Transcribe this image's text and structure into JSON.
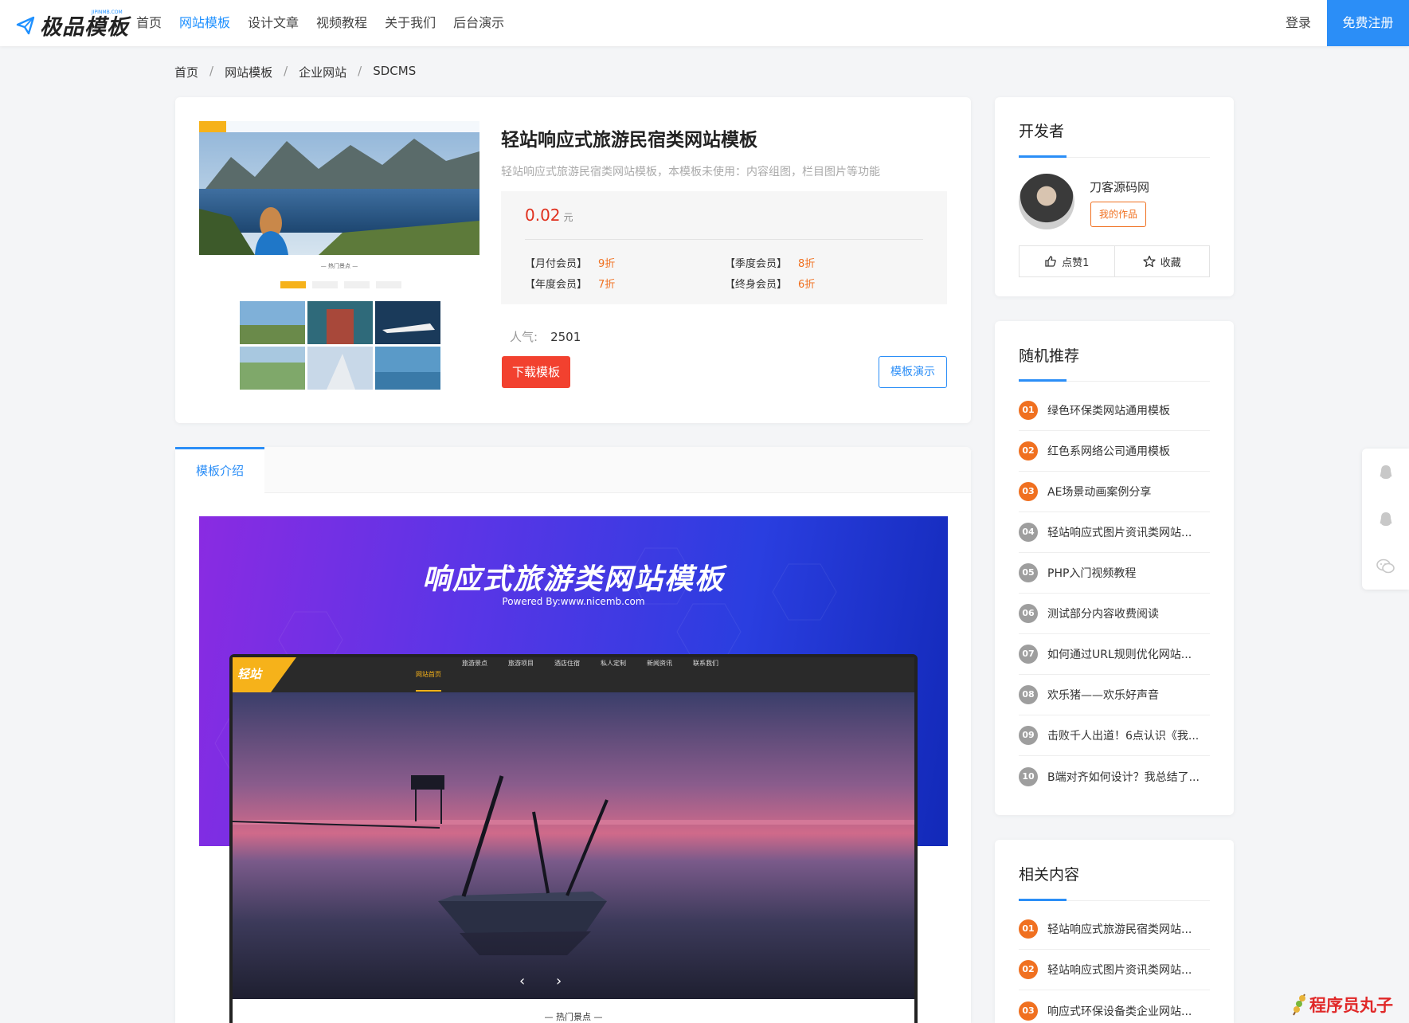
{
  "header": {
    "logo_text": "极品模板",
    "logo_sub": "JIPINMB.COM",
    "nav": [
      {
        "label": "首页",
        "active": false
      },
      {
        "label": "网站模板",
        "active": true
      },
      {
        "label": "设计文章",
        "active": false
      },
      {
        "label": "视频教程",
        "active": false
      },
      {
        "label": "关于我们",
        "active": false
      },
      {
        "label": "后台演示",
        "active": false
      }
    ],
    "login": "登录",
    "register": "免费注册"
  },
  "breadcrumb": [
    "首页",
    "网站模板",
    "企业网站",
    "SDCMS"
  ],
  "product": {
    "title": "轻站响应式旅游民宿类网站模板",
    "description": "轻站响应式旅游民宿类网站模板，本模板未使用：内容组图，栏目图片等功能",
    "price": "0.02",
    "price_unit": "元",
    "memberships": [
      {
        "label": "【月付会员】",
        "discount": "9折"
      },
      {
        "label": "【季度会员】",
        "discount": "8折"
      },
      {
        "label": "【年度会员】",
        "discount": "7折"
      },
      {
        "label": "【终身会员】",
        "discount": "6折"
      }
    ],
    "popularity_label": "人气:",
    "popularity": "2501",
    "download": "下载模板",
    "demo": "模板演示"
  },
  "tab": "模板介绍",
  "banner": {
    "title": "响应式旅游类网站模板",
    "subtitle": "Powered By:www.nicemb.com",
    "mock_logo": "轻站",
    "mock_nav": [
      "网站首页",
      "旅游景点",
      "旅游项目",
      "酒店住宿",
      "私人定制",
      "新闻资讯",
      "联系我们"
    ],
    "mock_footer": "— 热门景点 —"
  },
  "developer": {
    "heading": "开发者",
    "name": "刀客源码网",
    "works": "我的作品",
    "like": "点赞1",
    "favorite": "收藏"
  },
  "random": {
    "heading": "随机推荐",
    "items": [
      {
        "num": "01",
        "title": "绿色环保类网站通用模板"
      },
      {
        "num": "02",
        "title": "红色系网络公司通用模板"
      },
      {
        "num": "03",
        "title": "AE场景动画案例分享"
      },
      {
        "num": "04",
        "title": "轻站响应式图片资讯类网站..."
      },
      {
        "num": "05",
        "title": "PHP入门视频教程"
      },
      {
        "num": "06",
        "title": "测试部分内容收费阅读"
      },
      {
        "num": "07",
        "title": "如何通过URL规则优化网站..."
      },
      {
        "num": "08",
        "title": "欢乐猪——欢乐好声音"
      },
      {
        "num": "09",
        "title": "击败千人出道！6点认识《我..."
      },
      {
        "num": "10",
        "title": "B端对齐如何设计？我总结了..."
      }
    ]
  },
  "related": {
    "heading": "相关内容",
    "items": [
      {
        "num": "01",
        "title": "轻站响应式旅游民宿类网站..."
      },
      {
        "num": "02",
        "title": "轻站响应式图片资讯类网站..."
      },
      {
        "num": "03",
        "title": "响应式环保设备类企业网站..."
      }
    ]
  },
  "watermark": "程序员丸子",
  "colors": {
    "accent": "#2b8ef7",
    "danger": "#f2412f",
    "hot": "#f07020"
  }
}
